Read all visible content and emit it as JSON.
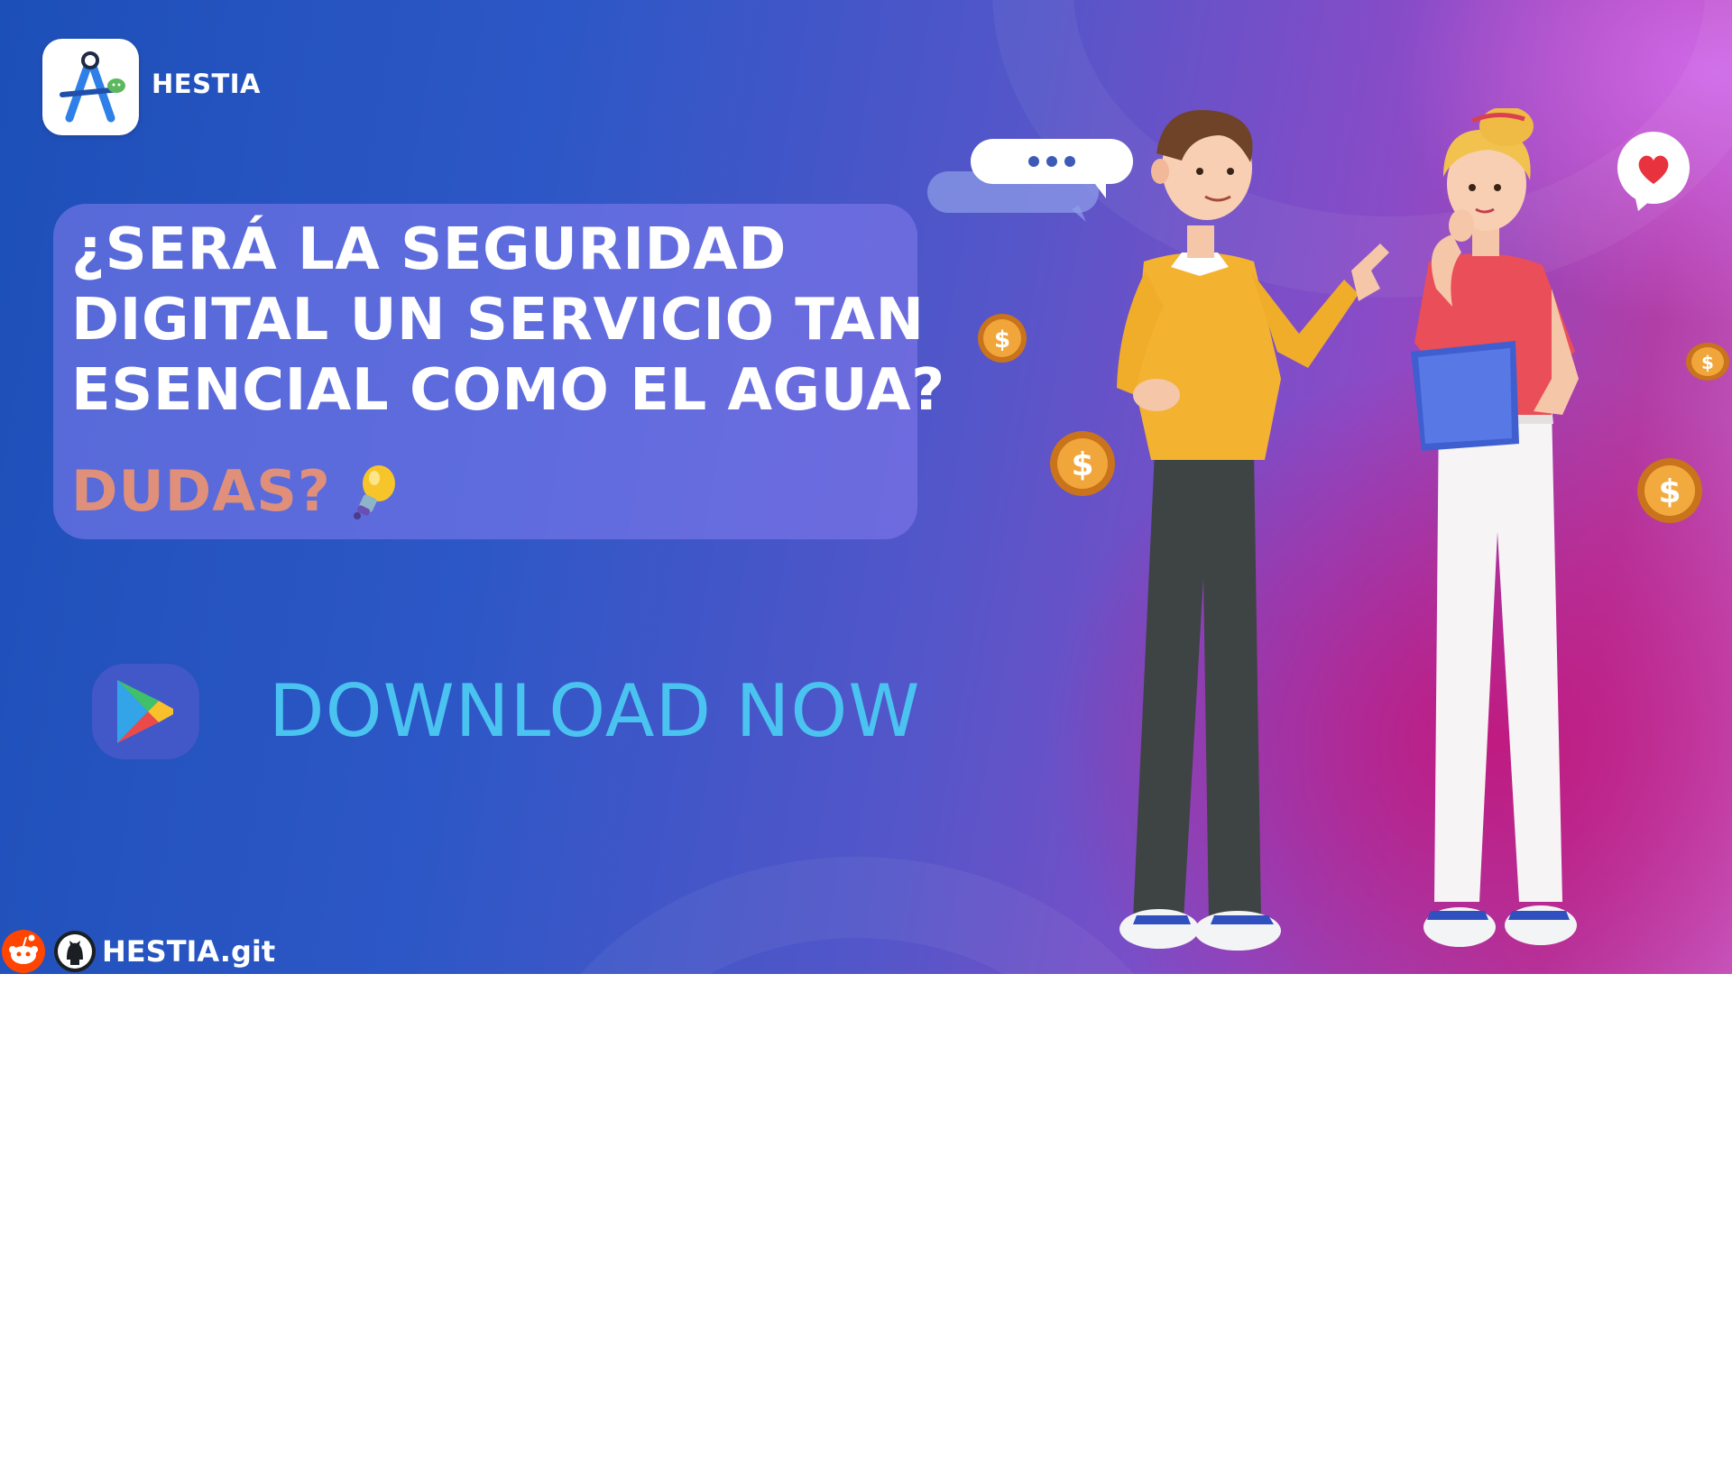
{
  "brand": {
    "name": "HESTIA"
  },
  "headline": {
    "lines": [
      "¿SERÁ LA SEGURIDAD",
      "DIGITAL UN SERVICIO TAN",
      "ESENCIAL COMO EL AGUA?"
    ],
    "sub": "DUDAS?"
  },
  "cta": {
    "label": "DOWNLOAD NOW"
  },
  "footer": {
    "repo": "HESTIA.git"
  },
  "colors": {
    "accent_sub": "#e0907a",
    "cta_text": "#4ac3f0",
    "card": "#877df0"
  },
  "icons": [
    "app-logo-icon",
    "lightbulb-icon",
    "google-play-icon",
    "reddit-icon",
    "github-icon",
    "heart-icon",
    "dollar-coin-icon",
    "chat-bubble-icon"
  ]
}
